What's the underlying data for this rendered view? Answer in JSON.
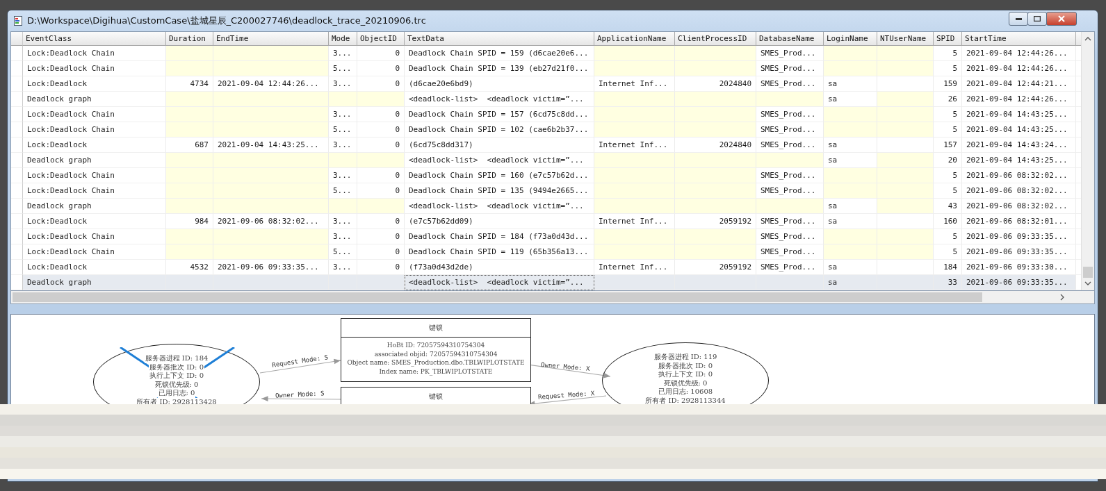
{
  "window": {
    "title": "D:\\Workspace\\Digihua\\CustomCase\\盐城星辰_C200027746\\deadlock_trace_20210906.trc"
  },
  "table": {
    "columns": [
      "EventClass",
      "Duration",
      "EndTime",
      "Mode",
      "ObjectID",
      "TextData",
      "ApplicationName",
      "ClientProcessID",
      "DatabaseName",
      "LoginName",
      "NTUserName",
      "SPID",
      "StartTime"
    ],
    "rows": [
      {
        "selected": false,
        "cells": [
          {
            "text": "Lock:Deadlock Chain"
          },
          {
            "null": true
          },
          {
            "null": true
          },
          {
            "text": "3..."
          },
          {
            "text": "0"
          },
          {
            "text": "Deadlock Chain SPID = 159 (d6cae20e6..."
          },
          {
            "null": true
          },
          {
            "null": true
          },
          {
            "text": "SMES_Prod..."
          },
          {
            "null": true
          },
          {
            "null": true
          },
          {
            "text": "5"
          },
          {
            "text": "2021-09-04 12:44:26..."
          }
        ]
      },
      {
        "selected": false,
        "cells": [
          {
            "text": "Lock:Deadlock Chain"
          },
          {
            "null": true
          },
          {
            "null": true
          },
          {
            "text": "5..."
          },
          {
            "text": "0"
          },
          {
            "text": "Deadlock Chain SPID = 139 (eb27d21f0..."
          },
          {
            "null": true
          },
          {
            "null": true
          },
          {
            "text": "SMES_Prod..."
          },
          {
            "null": true
          },
          {
            "null": true
          },
          {
            "text": "5"
          },
          {
            "text": "2021-09-04 12:44:26..."
          }
        ]
      },
      {
        "selected": false,
        "cells": [
          {
            "text": "Lock:Deadlock"
          },
          {
            "text": "4734"
          },
          {
            "text": "2021-09-04 12:44:26..."
          },
          {
            "text": "3..."
          },
          {
            "text": "0"
          },
          {
            "text": "(d6cae20e6bd9)"
          },
          {
            "text": "Internet Inf..."
          },
          {
            "text": "2024840"
          },
          {
            "text": "SMES_Prod..."
          },
          {
            "text": "sa"
          },
          {
            "null": false
          },
          {
            "text": "159"
          },
          {
            "text": "2021-09-04 12:44:21..."
          }
        ]
      },
      {
        "selected": false,
        "cells": [
          {
            "text": "Deadlock graph"
          },
          {
            "null": true
          },
          {
            "null": true
          },
          {
            "null": true
          },
          {
            "null": true
          },
          {
            "text": "<deadlock-list>  <deadlock victim=”..."
          },
          {
            "null": true
          },
          {
            "null": true
          },
          {
            "null": true
          },
          {
            "text": "sa"
          },
          {
            "null": true
          },
          {
            "text": "26"
          },
          {
            "text": "2021-09-04 12:44:26..."
          }
        ]
      },
      {
        "selected": false,
        "cells": [
          {
            "text": "Lock:Deadlock Chain"
          },
          {
            "null": true
          },
          {
            "null": true
          },
          {
            "text": "3..."
          },
          {
            "text": "0"
          },
          {
            "text": "Deadlock Chain SPID = 157 (6cd75c8dd..."
          },
          {
            "null": true
          },
          {
            "null": true
          },
          {
            "text": "SMES_Prod..."
          },
          {
            "null": true
          },
          {
            "null": true
          },
          {
            "text": "5"
          },
          {
            "text": "2021-09-04 14:43:25..."
          }
        ]
      },
      {
        "selected": false,
        "cells": [
          {
            "text": "Lock:Deadlock Chain"
          },
          {
            "null": true
          },
          {
            "null": true
          },
          {
            "text": "5..."
          },
          {
            "text": "0"
          },
          {
            "text": "Deadlock Chain SPID = 102 (cae6b2b37..."
          },
          {
            "null": true
          },
          {
            "null": true
          },
          {
            "text": "SMES_Prod..."
          },
          {
            "null": true
          },
          {
            "null": true
          },
          {
            "text": "5"
          },
          {
            "text": "2021-09-04 14:43:25..."
          }
        ]
      },
      {
        "selected": false,
        "cells": [
          {
            "text": "Lock:Deadlock"
          },
          {
            "text": "687"
          },
          {
            "text": "2021-09-04 14:43:25..."
          },
          {
            "text": "3..."
          },
          {
            "text": "0"
          },
          {
            "text": "(6cd75c8dd317)"
          },
          {
            "text": "Internet Inf..."
          },
          {
            "text": "2024840"
          },
          {
            "text": "SMES_Prod..."
          },
          {
            "text": "sa"
          },
          {
            "null": false
          },
          {
            "text": "157"
          },
          {
            "text": "2021-09-04 14:43:24..."
          }
        ]
      },
      {
        "selected": false,
        "cells": [
          {
            "text": "Deadlock graph"
          },
          {
            "null": true
          },
          {
            "null": true
          },
          {
            "null": true
          },
          {
            "null": true
          },
          {
            "text": "<deadlock-list>  <deadlock victim=”..."
          },
          {
            "null": true
          },
          {
            "null": true
          },
          {
            "null": true
          },
          {
            "text": "sa"
          },
          {
            "null": true
          },
          {
            "text": "20"
          },
          {
            "text": "2021-09-04 14:43:25..."
          }
        ]
      },
      {
        "selected": false,
        "cells": [
          {
            "text": "Lock:Deadlock Chain"
          },
          {
            "null": true
          },
          {
            "null": true
          },
          {
            "text": "3..."
          },
          {
            "text": "0"
          },
          {
            "text": "Deadlock Chain SPID = 160 (e7c57b62d..."
          },
          {
            "null": true
          },
          {
            "null": true
          },
          {
            "text": "SMES_Prod..."
          },
          {
            "null": true
          },
          {
            "null": true
          },
          {
            "text": "5"
          },
          {
            "text": "2021-09-06 08:32:02..."
          }
        ]
      },
      {
        "selected": false,
        "cells": [
          {
            "text": "Lock:Deadlock Chain"
          },
          {
            "null": true
          },
          {
            "null": true
          },
          {
            "text": "5..."
          },
          {
            "text": "0"
          },
          {
            "text": "Deadlock Chain SPID = 135 (9494e2665..."
          },
          {
            "null": true
          },
          {
            "null": true
          },
          {
            "text": "SMES_Prod..."
          },
          {
            "null": true
          },
          {
            "null": true
          },
          {
            "text": "5"
          },
          {
            "text": "2021-09-06 08:32:02..."
          }
        ]
      },
      {
        "selected": false,
        "cells": [
          {
            "text": "Deadlock graph"
          },
          {
            "null": true
          },
          {
            "null": true
          },
          {
            "null": true
          },
          {
            "null": true
          },
          {
            "text": "<deadlock-list>  <deadlock victim=”..."
          },
          {
            "null": true
          },
          {
            "null": true
          },
          {
            "null": true
          },
          {
            "text": "sa"
          },
          {
            "null": true
          },
          {
            "text": "43"
          },
          {
            "text": "2021-09-06 08:32:02..."
          }
        ]
      },
      {
        "selected": false,
        "cells": [
          {
            "text": "Lock:Deadlock"
          },
          {
            "text": "984"
          },
          {
            "text": "2021-09-06 08:32:02..."
          },
          {
            "text": "3..."
          },
          {
            "text": "0"
          },
          {
            "text": "(e7c57b62dd09)"
          },
          {
            "text": "Internet Inf..."
          },
          {
            "text": "2059192"
          },
          {
            "text": "SMES_Prod..."
          },
          {
            "text": "sa"
          },
          {
            "null": false
          },
          {
            "text": "160"
          },
          {
            "text": "2021-09-06 08:32:01..."
          }
        ]
      },
      {
        "selected": false,
        "cells": [
          {
            "text": "Lock:Deadlock Chain"
          },
          {
            "null": true
          },
          {
            "null": true
          },
          {
            "text": "3..."
          },
          {
            "text": "0"
          },
          {
            "text": "Deadlock Chain SPID = 184 (f73a0d43d..."
          },
          {
            "null": true
          },
          {
            "null": true
          },
          {
            "text": "SMES_Prod..."
          },
          {
            "null": true
          },
          {
            "null": true
          },
          {
            "text": "5"
          },
          {
            "text": "2021-09-06 09:33:35..."
          }
        ]
      },
      {
        "selected": false,
        "cells": [
          {
            "text": "Lock:Deadlock Chain"
          },
          {
            "null": true
          },
          {
            "null": true
          },
          {
            "text": "5..."
          },
          {
            "text": "0"
          },
          {
            "text": "Deadlock Chain SPID = 119 (65b356a13..."
          },
          {
            "null": true
          },
          {
            "null": true
          },
          {
            "text": "SMES_Prod..."
          },
          {
            "null": true
          },
          {
            "null": true
          },
          {
            "text": "5"
          },
          {
            "text": "2021-09-06 09:33:35..."
          }
        ]
      },
      {
        "selected": false,
        "cells": [
          {
            "text": "Lock:Deadlock"
          },
          {
            "text": "4532"
          },
          {
            "text": "2021-09-06 09:33:35..."
          },
          {
            "text": "3..."
          },
          {
            "text": "0"
          },
          {
            "text": "(f73a0d43d2de)"
          },
          {
            "text": "Internet Inf..."
          },
          {
            "text": "2059192"
          },
          {
            "text": "SMES_Prod..."
          },
          {
            "text": "sa"
          },
          {
            "null": false
          },
          {
            "text": "184"
          },
          {
            "text": "2021-09-06 09:33:30..."
          }
        ]
      },
      {
        "selected": true,
        "cells": [
          {
            "text": "Deadlock graph"
          },
          {},
          {},
          {},
          {},
          {
            "text": "<deadlock-list>  <deadlock victim=”...",
            "focused": true
          },
          {},
          {},
          {},
          {
            "text": "sa"
          },
          {},
          {
            "text": "33"
          },
          {
            "text": "2021-09-06 09:33:35..."
          }
        ]
      }
    ]
  },
  "deadlock_graph": {
    "nodes": [
      {
        "kind": "process",
        "victim": true,
        "lines": [
          "服务器进程 ID: 184",
          "服务器批次 ID: 0",
          "执行上下文 ID: 0",
          "死锁优先级: 0",
          "已用日志: 0",
          "所有者 ID: 2928113428"
        ]
      },
      {
        "kind": "resource",
        "title": "键锁",
        "lines": [
          "HoBt ID: 72057594310754304",
          "associated objid: 72057594310754304",
          "Object name: SMES_Production.dbo.TBLWIPLOTSTATE",
          "Index name: PK_TBLWIPLOTSTATE"
        ]
      },
      {
        "kind": "resource",
        "title": "键锁"
      },
      {
        "kind": "process",
        "victim": false,
        "lines": [
          "服务器进程 ID: 119",
          "服务器批次 ID: 0",
          "执行上下文 ID: 0",
          "死锁优先级: 0",
          "已用日志: 10608",
          "所有者 ID: 2928113344"
        ]
      }
    ],
    "edges": [
      {
        "label": "Request Mode: S"
      },
      {
        "label": "Owner Mode: S"
      },
      {
        "label": "Owner Mode: X"
      },
      {
        "label": "Request Mode: X"
      }
    ]
  }
}
